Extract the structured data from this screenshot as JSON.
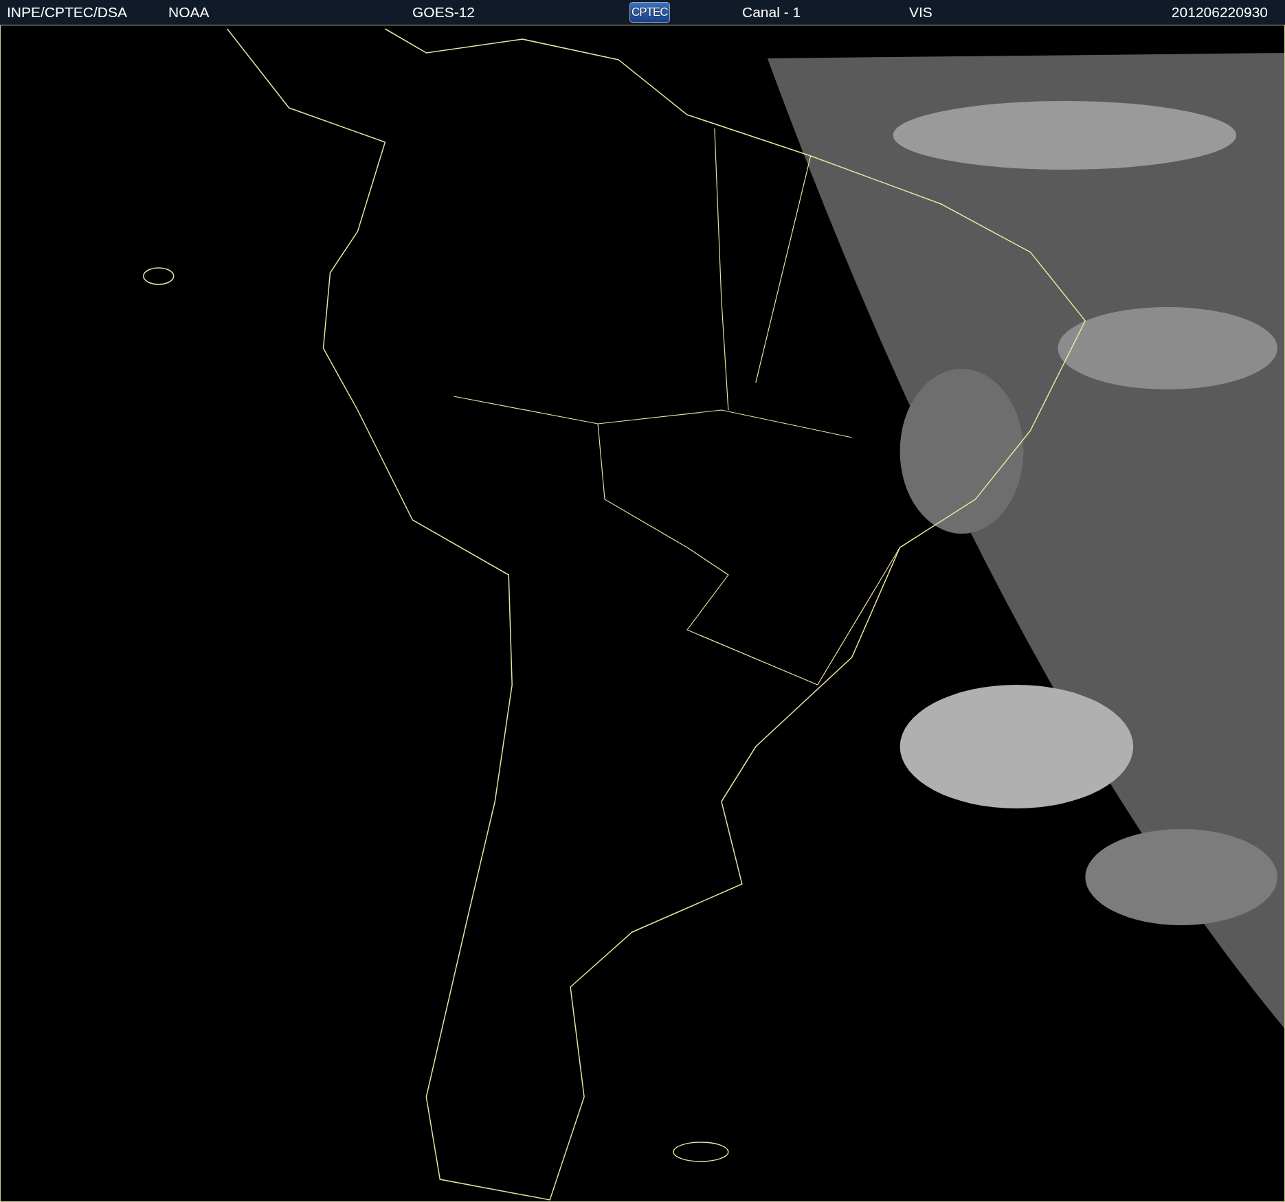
{
  "header": {
    "items": [
      {
        "kind": "text",
        "text": "INPE/CPTEC/DSA"
      },
      {
        "kind": "text",
        "text": "NOAA"
      },
      {
        "kind": "text",
        "text": "GOES-12"
      },
      {
        "kind": "logo",
        "text": "CPTEC"
      },
      {
        "kind": "text",
        "text": "Canal - 1"
      },
      {
        "kind": "text",
        "text": "VIS"
      },
      {
        "kind": "text",
        "text": "201206220930"
      }
    ]
  }
}
